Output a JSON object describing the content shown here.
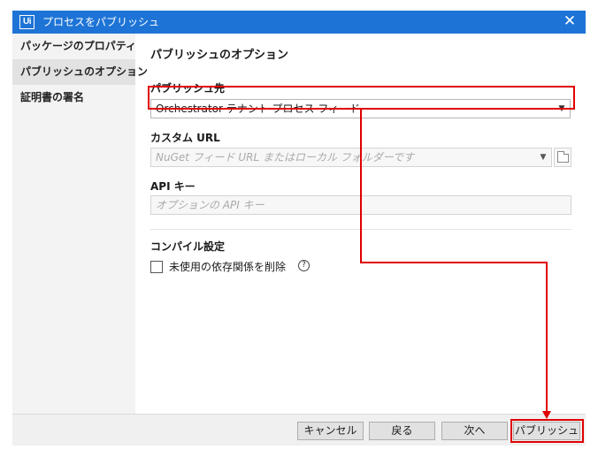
{
  "window": {
    "logo_text": "Ui",
    "title": "プロセスをパブリッシュ",
    "close_glyph": "✕"
  },
  "sidebar": {
    "items": [
      {
        "label": "パッケージのプロパティ"
      },
      {
        "label": "パブリッシュのオプション",
        "active": true
      },
      {
        "label": "証明書の署名"
      }
    ]
  },
  "main": {
    "heading": "パブリッシュのオプション",
    "publish_target": {
      "label": "パブリッシュ先",
      "selected_value": "Orchestrator テナント プロセス フィード"
    },
    "custom_url": {
      "label": "カスタム URL",
      "placeholder": "NuGet フィード URL またはローカル フォルダーです"
    },
    "api_key": {
      "label": "API キー",
      "placeholder": "オプションの API キー"
    },
    "compile_settings": {
      "label": "コンパイル設定",
      "remove_unused_label": "未使用の依存関係を削除",
      "remove_unused_checked": false,
      "help_glyph": "?"
    }
  },
  "footer": {
    "cancel_label": "キャンセル",
    "back_label": "戻る",
    "next_label": "次へ",
    "publish_label": "パブリッシュ"
  },
  "icons": {
    "dropdown_arrow": "chevron-down-icon",
    "folder": "folder-icon",
    "help": "question-circle-icon"
  },
  "colors": {
    "titlebar": "#1e74d6",
    "annotation_red": "#e00000",
    "sidebar_bg": "#f3f3f3",
    "sidebar_active": "#e2e2e2"
  }
}
